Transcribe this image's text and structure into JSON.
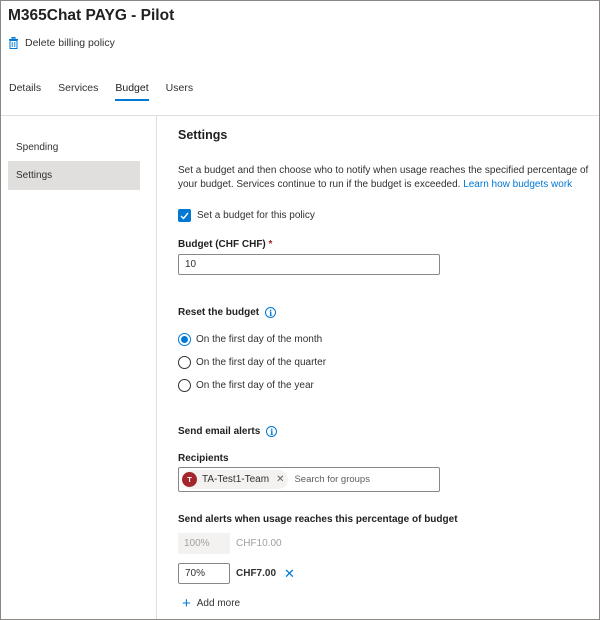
{
  "header": {
    "title": "M365Chat PAYG - Pilot",
    "delete_label": "Delete billing policy"
  },
  "tabs": [
    {
      "label": "Details",
      "active": false
    },
    {
      "label": "Services",
      "active": false
    },
    {
      "label": "Budget",
      "active": true
    },
    {
      "label": "Users",
      "active": false
    }
  ],
  "sidebar": {
    "items": [
      {
        "label": "Spending",
        "selected": false
      },
      {
        "label": "Settings",
        "selected": true
      }
    ]
  },
  "settings": {
    "heading": "Settings",
    "description": "Set a budget and then choose who to notify when usage reaches the specified percentage of your budget. Services continue to run if the budget is exceeded.",
    "learn_link": "Learn how budgets work",
    "set_budget_checkbox": {
      "label": "Set a budget for this policy",
      "checked": true
    },
    "budget_label": "Budget (CHF CHF)",
    "required_mark": "*",
    "budget_value": "10",
    "reset_label": "Reset the budget",
    "reset_options": [
      {
        "label": "On the first day of the month",
        "selected": true
      },
      {
        "label": "On the first day of the quarter",
        "selected": false
      },
      {
        "label": "On the first day of the year",
        "selected": false
      }
    ],
    "email_alerts_label": "Send email alerts",
    "recipients_label": "Recipients",
    "recipient": {
      "initial": "T",
      "name": "TA-Test1-Team"
    },
    "search_placeholder": "Search for groups",
    "alerts_threshold_label": "Send alerts when usage reaches this percentage of budget",
    "thresholds": [
      {
        "percent": "100%",
        "amount": "CHF10.00",
        "editable": false
      },
      {
        "percent": "70%",
        "amount": "CHF7.00",
        "editable": true
      }
    ],
    "add_more_label": "Add more"
  },
  "colors": {
    "accent": "#0078d4",
    "avatar": "#a4262c",
    "selected_nav": "#e1dfdd"
  }
}
